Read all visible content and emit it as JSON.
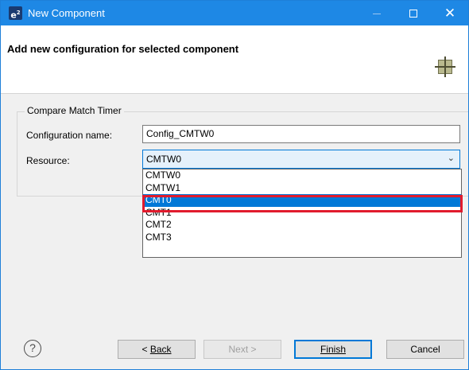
{
  "window": {
    "app_icon_letter": "e",
    "app_icon_sup": "2",
    "title": "New Component",
    "minimize_label": "",
    "maximize_label": "",
    "close_label": "✕"
  },
  "header": {
    "title": "Add new configuration for selected component"
  },
  "group": {
    "legend": "Compare Match Timer",
    "config_name_label": "Configuration name:",
    "config_name_value": "Config_CMTW0",
    "resource_label": "Resource:",
    "resource_value": "CMTW0"
  },
  "dropdown": {
    "options": [
      "CMTW0",
      "CMTW1",
      "CMT0",
      "CMT1",
      "CMT2",
      "CMT3"
    ],
    "selected_index": 2
  },
  "buttons": {
    "help": "?",
    "back_prefix": "< ",
    "back": "Back",
    "next": "Next >",
    "finish": "Finish",
    "cancel": "Cancel"
  },
  "colors": {
    "titlebar": "#1e88e5",
    "selection": "#0078d7",
    "highlight_box": "#e11b2d"
  }
}
